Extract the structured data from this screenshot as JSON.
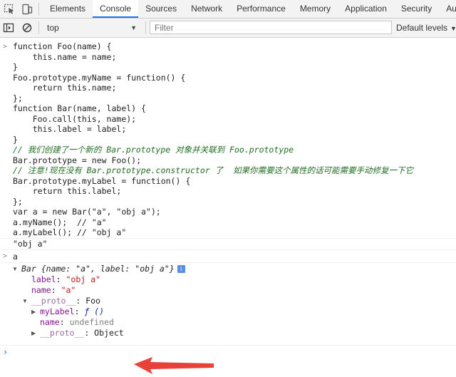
{
  "tabs": [
    {
      "label": "Elements"
    },
    {
      "label": "Console",
      "active": true
    },
    {
      "label": "Sources"
    },
    {
      "label": "Network"
    },
    {
      "label": "Performance"
    },
    {
      "label": "Memory"
    },
    {
      "label": "Application"
    },
    {
      "label": "Security"
    },
    {
      "label": "Audi"
    }
  ],
  "toolbar": {
    "context": "top",
    "filter_placeholder": "Filter",
    "levels": "Default levels"
  },
  "code_lines": [
    "function Foo(name) {",
    "    this.name = name;",
    "}",
    "Foo.prototype.myName = function() {",
    "    return this.name;",
    "};",
    "function Bar(name, label) {",
    "    Foo.call(this, name);",
    "    this.label = label;",
    "}",
    "// 我们创建了一个新的 Bar.prototype 对象并关联到 Foo.prototype",
    "Bar.prototype = new Foo();",
    "// 注意!现在没有 Bar.prototype.constructor 了  如果你需要这个属性的话可能需要手动修复一下它",
    "Bar.prototype.myLabel = function() {",
    "    return this.label;",
    "};",
    "var a = new Bar(\"a\", \"obj a\");",
    "a.myName();  // \"a\"",
    "a.myLabel(); // \"obj a\""
  ],
  "result1": "\"obj a\"",
  "input2": "a",
  "object": {
    "summary_name": "Bar",
    "summary_body": "{name: \"a\", label: \"obj a\"}",
    "info": "i",
    "props": [
      {
        "key": "label",
        "value": "\"obj a\""
      },
      {
        "key": "name",
        "value": "\"a\""
      }
    ],
    "proto": {
      "key": "__proto__",
      "value": "Foo",
      "props": [
        {
          "key": "myLabel",
          "value": "ƒ ()"
        },
        {
          "key": "name",
          "value": "undefined"
        },
        {
          "key": "__proto__",
          "value": "Object"
        }
      ]
    }
  },
  "colors": {
    "accent": "#1a73e8",
    "arrow": "#e8413a",
    "keyword": "#aa0d91",
    "comment": "#236e25",
    "string": "#c41a16"
  }
}
